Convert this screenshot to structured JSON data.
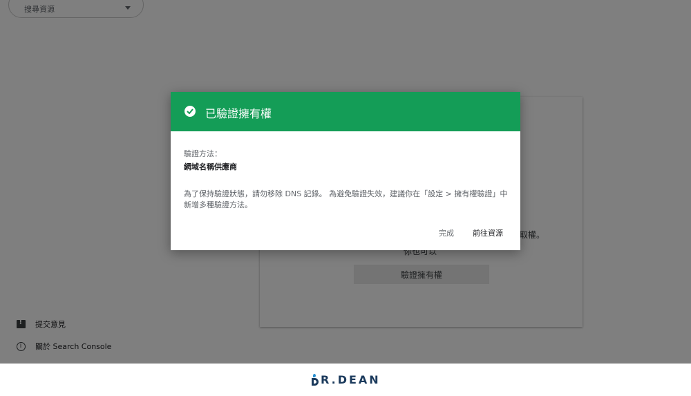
{
  "app": {
    "property_select": {
      "label": "搜尋資源"
    },
    "card": {
      "ownership_text": "取權。",
      "sub_text": "你也可以",
      "verify_button": "驗證擁有權"
    },
    "sidebar": {
      "feedback_label": "提交意見",
      "about_label": "關於 Search Console"
    }
  },
  "dialog": {
    "title": "已驗證擁有權",
    "method_label": "驗證方法：",
    "method_value": "網域名稱供應商",
    "note": "為了保持驗證狀態，請勿移除 DNS 記錄。 為避免驗證失效，建議你在「設定 > 擁有權驗證」中新增多種驗證方法。",
    "done_button": "完成",
    "goto_button": "前往資源"
  },
  "footer": {
    "brand": "R.DEAN"
  },
  "colors": {
    "header_green": "#149d57",
    "brand_navy": "#1b3a5c"
  }
}
